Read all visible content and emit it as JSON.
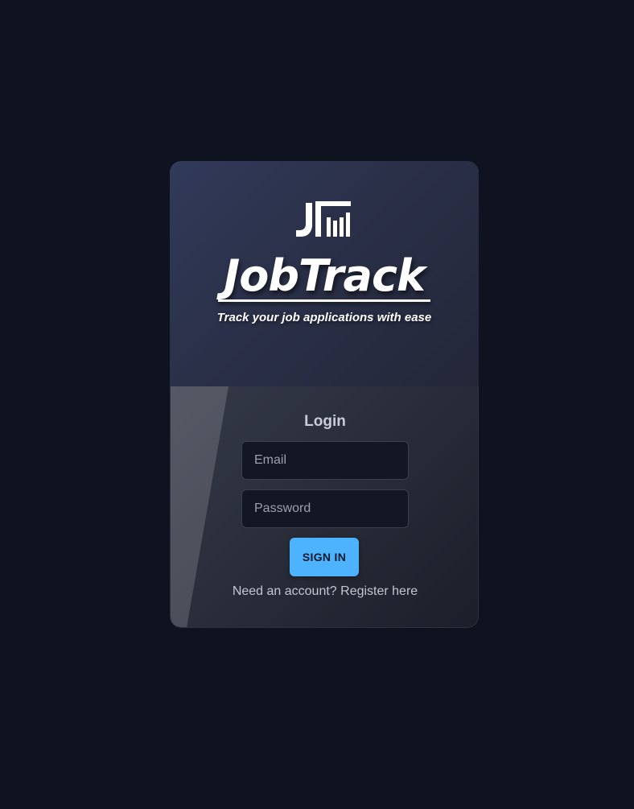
{
  "brand": {
    "logo_icon": "jt-bar-chart-logo",
    "name": "JobTrack",
    "tagline": "Track your job applications with ease"
  },
  "login": {
    "title": "Login",
    "email_placeholder": "Email",
    "email_value": "",
    "password_placeholder": "Password",
    "password_value": "",
    "submit_label": "SIGN IN",
    "register_link": "Need an account? Register here"
  },
  "colors": {
    "background": "#0f1320",
    "accent": "#4db3ff",
    "card_top": "#2a3048",
    "card_bottom": "#272b37"
  }
}
